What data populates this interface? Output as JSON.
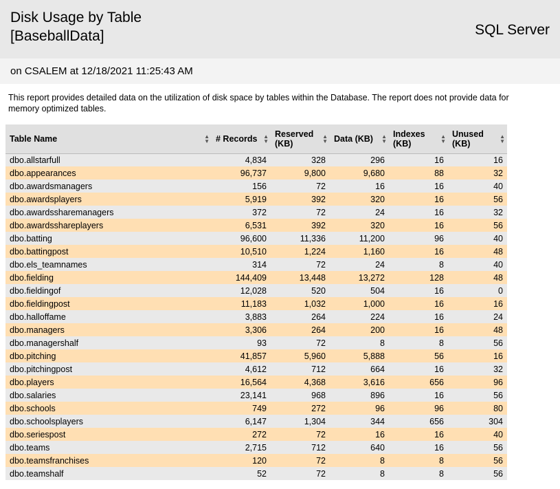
{
  "header": {
    "title_line1": "Disk Usage by Table",
    "title_line2": "[BaseballData]",
    "brand": "SQL Server"
  },
  "subheader": "on CSALEM at 12/18/2021 11:25:43 AM",
  "description": "This report provides detailed data on the utilization of disk space by tables within the Database. The report does not provide data for memory optimized tables.",
  "columns": [
    "Table Name",
    "# Records",
    "Reserved (KB)",
    "Data (KB)",
    "Indexes (KB)",
    "Unused (KB)"
  ],
  "rows": [
    {
      "name": "dbo.allstarfull",
      "records": "4,834",
      "reserved": "328",
      "data": "296",
      "indexes": "16",
      "unused": "16"
    },
    {
      "name": "dbo.appearances",
      "records": "96,737",
      "reserved": "9,800",
      "data": "9,680",
      "indexes": "88",
      "unused": "32"
    },
    {
      "name": "dbo.awardsmanagers",
      "records": "156",
      "reserved": "72",
      "data": "16",
      "indexes": "16",
      "unused": "40"
    },
    {
      "name": "dbo.awardsplayers",
      "records": "5,919",
      "reserved": "392",
      "data": "320",
      "indexes": "16",
      "unused": "56"
    },
    {
      "name": "dbo.awardssharemanagers",
      "records": "372",
      "reserved": "72",
      "data": "24",
      "indexes": "16",
      "unused": "32"
    },
    {
      "name": "dbo.awardsshareplayers",
      "records": "6,531",
      "reserved": "392",
      "data": "320",
      "indexes": "16",
      "unused": "56"
    },
    {
      "name": "dbo.batting",
      "records": "96,600",
      "reserved": "11,336",
      "data": "11,200",
      "indexes": "96",
      "unused": "40"
    },
    {
      "name": "dbo.battingpost",
      "records": "10,510",
      "reserved": "1,224",
      "data": "1,160",
      "indexes": "16",
      "unused": "48"
    },
    {
      "name": "dbo.els_teamnames",
      "records": "314",
      "reserved": "72",
      "data": "24",
      "indexes": "8",
      "unused": "40"
    },
    {
      "name": "dbo.fielding",
      "records": "144,409",
      "reserved": "13,448",
      "data": "13,272",
      "indexes": "128",
      "unused": "48"
    },
    {
      "name": "dbo.fieldingof",
      "records": "12,028",
      "reserved": "520",
      "data": "504",
      "indexes": "16",
      "unused": "0"
    },
    {
      "name": "dbo.fieldingpost",
      "records": "11,183",
      "reserved": "1,032",
      "data": "1,000",
      "indexes": "16",
      "unused": "16"
    },
    {
      "name": "dbo.halloffame",
      "records": "3,883",
      "reserved": "264",
      "data": "224",
      "indexes": "16",
      "unused": "24"
    },
    {
      "name": "dbo.managers",
      "records": "3,306",
      "reserved": "264",
      "data": "200",
      "indexes": "16",
      "unused": "48"
    },
    {
      "name": "dbo.managershalf",
      "records": "93",
      "reserved": "72",
      "data": "8",
      "indexes": "8",
      "unused": "56"
    },
    {
      "name": "dbo.pitching",
      "records": "41,857",
      "reserved": "5,960",
      "data": "5,888",
      "indexes": "56",
      "unused": "16"
    },
    {
      "name": "dbo.pitchingpost",
      "records": "4,612",
      "reserved": "712",
      "data": "664",
      "indexes": "16",
      "unused": "32"
    },
    {
      "name": "dbo.players",
      "records": "16,564",
      "reserved": "4,368",
      "data": "3,616",
      "indexes": "656",
      "unused": "96"
    },
    {
      "name": "dbo.salaries",
      "records": "23,141",
      "reserved": "968",
      "data": "896",
      "indexes": "16",
      "unused": "56"
    },
    {
      "name": "dbo.schools",
      "records": "749",
      "reserved": "272",
      "data": "96",
      "indexes": "96",
      "unused": "80"
    },
    {
      "name": "dbo.schoolsplayers",
      "records": "6,147",
      "reserved": "1,304",
      "data": "344",
      "indexes": "656",
      "unused": "304"
    },
    {
      "name": "dbo.seriespost",
      "records": "272",
      "reserved": "72",
      "data": "16",
      "indexes": "16",
      "unused": "40"
    },
    {
      "name": "dbo.teams",
      "records": "2,715",
      "reserved": "712",
      "data": "640",
      "indexes": "16",
      "unused": "56"
    },
    {
      "name": "dbo.teamsfranchises",
      "records": "120",
      "reserved": "72",
      "data": "8",
      "indexes": "8",
      "unused": "56"
    },
    {
      "name": "dbo.teamshalf",
      "records": "52",
      "reserved": "72",
      "data": "8",
      "indexes": "8",
      "unused": "56"
    }
  ]
}
